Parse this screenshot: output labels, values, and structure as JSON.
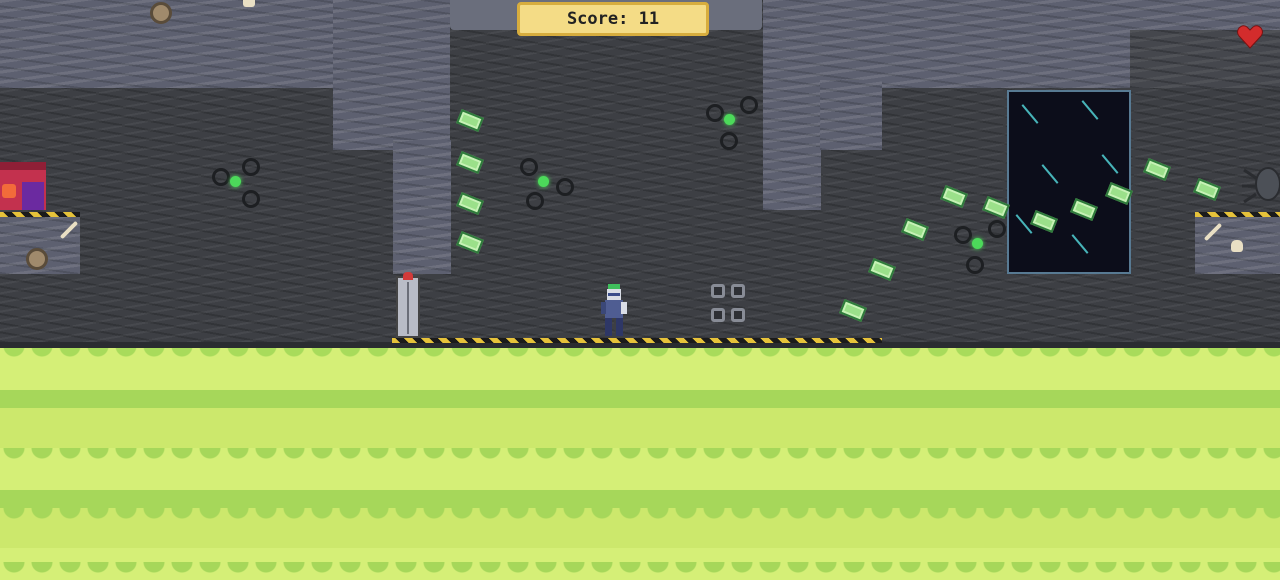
{
  "hud": {
    "score_label": "Score: 11",
    "lives": 1,
    "life_icon": "heart-icon"
  },
  "colors": {
    "slime": "#d5ef77",
    "slime_dark": "#a6d75a",
    "rock": "#5d6070",
    "score_panel": "#f4dc86",
    "heart": "#d32c2c",
    "orb_core": "#4cd95a"
  },
  "icons": [
    "heart-icon",
    "cash-icon",
    "orb-enemy-icon",
    "player-sprite",
    "portal",
    "door",
    "vent",
    "bone-icon",
    "gear-icon",
    "skull-icon",
    "spider-enemy-icon"
  ]
}
